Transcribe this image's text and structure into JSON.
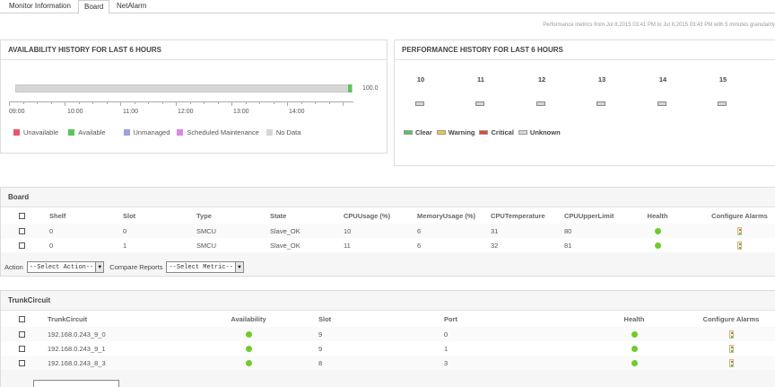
{
  "tabs": [
    {
      "label": "Monitor Information",
      "active": false
    },
    {
      "label": "Board",
      "active": true
    },
    {
      "label": "NetAlarm",
      "active": false
    }
  ],
  "perf_note": "Performance metrics from Jul 8,2015 03:41 PM to Jul 8,2015 03:43 PM with 5 minutes granularity",
  "availability": {
    "title": "AVAILABILITY HISTORY FOR LAST 6 HOURS",
    "bar_value": "100.0",
    "available_fraction": 0.01,
    "times": [
      "09:00",
      "10:00",
      "11:00",
      "12:00",
      "13:00",
      "14:00"
    ],
    "legend": [
      {
        "label": "Unavailable",
        "color": "#e8566b"
      },
      {
        "label": "Available",
        "color": "#5cc45c"
      },
      {
        "label": "Unmanaged",
        "color": "#9da1dd"
      },
      {
        "label": "Scheduled Maintenance",
        "color": "#d98ae4"
      },
      {
        "label": "No Data",
        "color": "#d6d6d6"
      }
    ]
  },
  "performance": {
    "title": "PERFORMANCE HISTORY FOR LAST 6 HOURS",
    "hours": [
      "10",
      "11",
      "12",
      "13",
      "14",
      "15"
    ],
    "legend": [
      {
        "label": "Clear",
        "color": "#5cc45c"
      },
      {
        "label": "Warning",
        "color": "#f3c741"
      },
      {
        "label": "Critical",
        "color": "#e04a2c"
      },
      {
        "label": "Unknown",
        "color": "#d6d6d6"
      }
    ]
  },
  "board": {
    "title": "Board",
    "columns": [
      "Shelf",
      "Slot",
      "Type",
      "State",
      "CPUUsage (%)",
      "MemoryUsage (%)",
      "CPUTemperature",
      "CPUUpperLimit",
      "Health",
      "Configure Alarms"
    ],
    "rows": [
      {
        "shelf": "0",
        "slot": "0",
        "type": "SMCU",
        "state": "Slave_OK",
        "cpu": "10",
        "mem": "6",
        "temp": "31",
        "limit": "80",
        "health": "green",
        "alarm": "alarm-icon"
      },
      {
        "shelf": "0",
        "slot": "1",
        "type": "SMCU",
        "state": "Slave_OK",
        "cpu": "11",
        "mem": "6",
        "temp": "32",
        "limit": "81",
        "health": "green",
        "alarm": "alarm-icon"
      }
    ],
    "action_label": "Action",
    "action_select": "--Select Action--",
    "compare_label": "Compare Reports",
    "compare_select": "--Select Metric--"
  },
  "trunk": {
    "title": "TrunkCircuit",
    "columns": [
      "TrunkCircuit",
      "Availability",
      "Slot",
      "Port",
      "Health",
      "Configure Alarms"
    ],
    "rows": [
      {
        "name": "192.168.0.243_9_0",
        "availability": "green",
        "slot": "9",
        "port": "0",
        "health": "green",
        "alarm": "alarm-icon"
      },
      {
        "name": "192.168.0.243_9_1",
        "availability": "green",
        "slot": "9",
        "port": "1",
        "health": "green",
        "alarm": "alarm-icon"
      },
      {
        "name": "192.168.0.243_8_3",
        "availability": "green",
        "slot": "8",
        "port": "3",
        "health": "green",
        "alarm": "alarm-icon"
      }
    ]
  }
}
